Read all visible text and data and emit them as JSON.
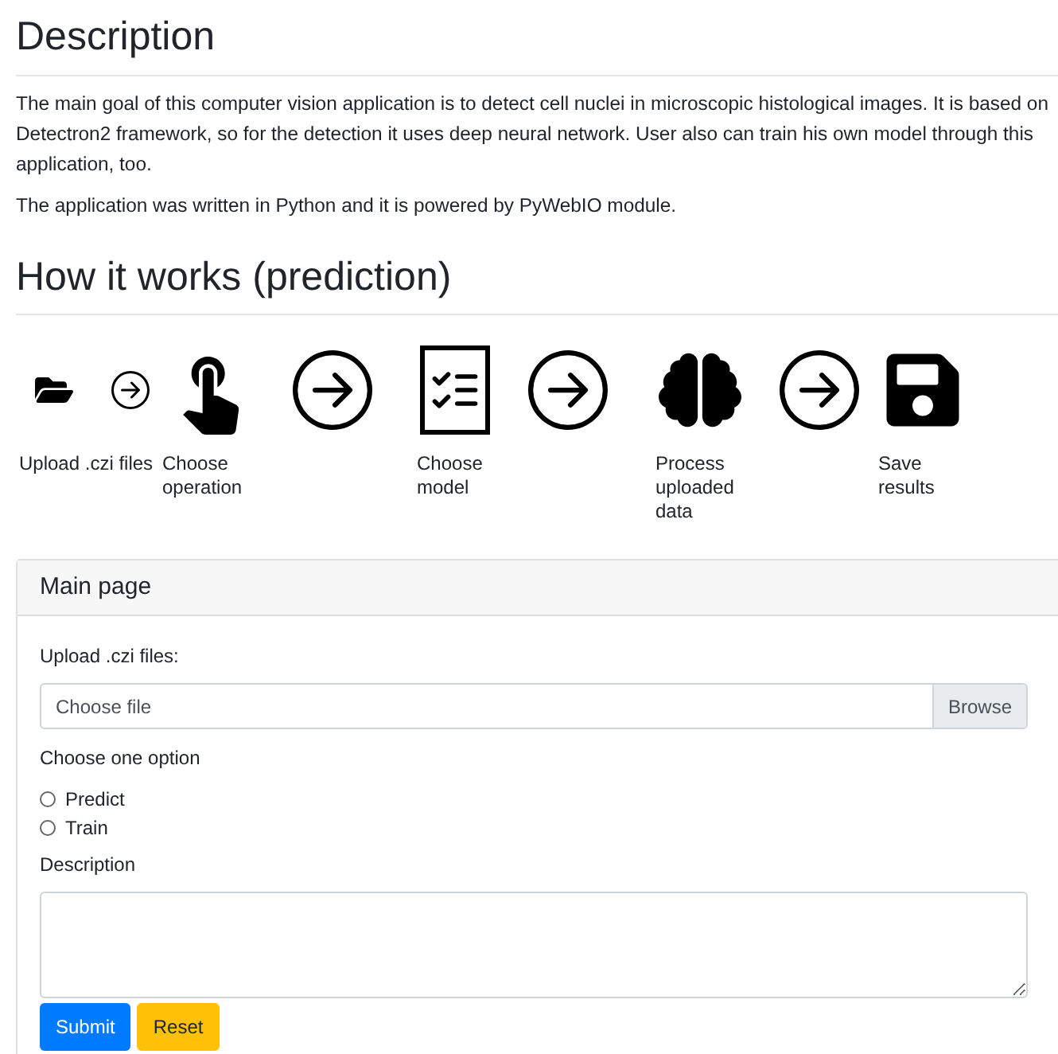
{
  "description": {
    "title": "Description",
    "paragraphs": [
      "The main goal of this computer vision application is to detect cell nuclei in microscopic histological images. It is based on Detectron2 framework, so for the detection it uses deep neural network. User also can train his own model through this application, too.",
      "The application was written in Python and it is powered by PyWebIO module."
    ]
  },
  "how_it_works": {
    "title": "How it works (prediction)",
    "steps": [
      {
        "label": "Upload .czi files"
      },
      {
        "label": "Choose operation"
      },
      {
        "label": "Choose model"
      },
      {
        "label": "Process uploaded data"
      },
      {
        "label": "Save results"
      }
    ]
  },
  "card": {
    "title": "Main page",
    "upload": {
      "label": "Upload .czi files:",
      "placeholder": "Choose file",
      "button": "Browse"
    },
    "option": {
      "label": "Choose one option",
      "choices": [
        {
          "label": "Predict",
          "selected": false
        },
        {
          "label": "Train",
          "selected": false
        }
      ]
    },
    "description": {
      "label": "Description"
    },
    "buttons": [
      {
        "label": "Submit",
        "kind": "primary"
      },
      {
        "label": "Reset",
        "kind": "warning"
      }
    ]
  }
}
